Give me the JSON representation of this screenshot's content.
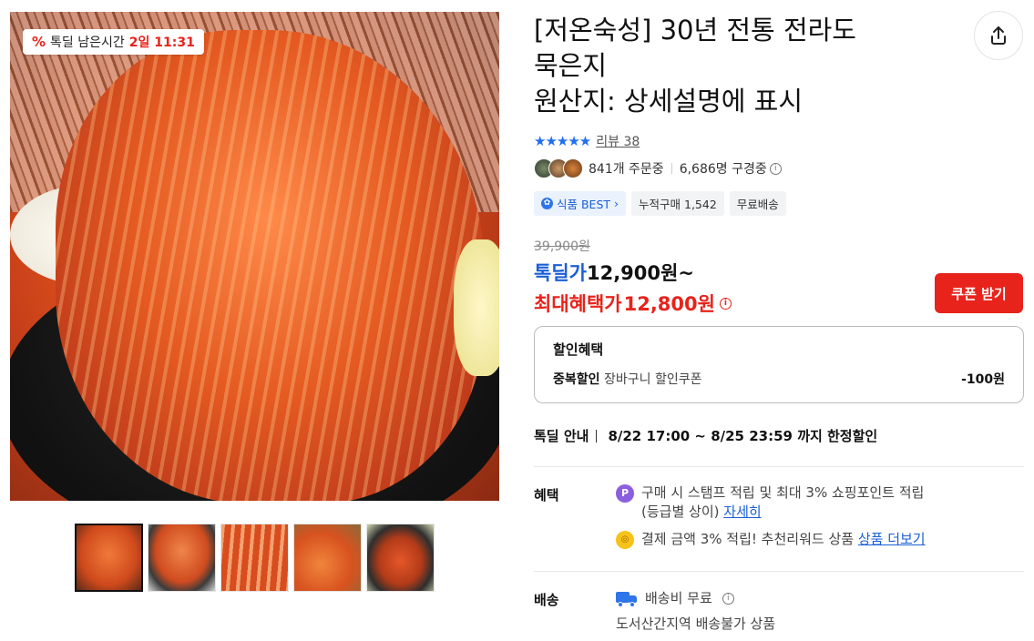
{
  "product": {
    "deal_badge": {
      "label": "톡딜 남은시간",
      "time": "2일 11:31"
    },
    "title_lines": [
      "[저온숙성] 30년 전통 전라도",
      "묵은지",
      "원산지: 상세설명에 표시"
    ],
    "rating": {
      "stars": "★★★★★",
      "review_label": "리뷰 38"
    },
    "orders": {
      "ordering": "841개 주문중",
      "subscribers": "6,686명 구경중"
    },
    "tags": [
      "식품 BEST",
      "누적구매 1,542",
      "무료배송"
    ],
    "prices": {
      "original": "39,900원",
      "deal_label": "톡딜가",
      "deal_value": "12,900원~",
      "max_label": "최대혜택가",
      "max_value": "12,800원"
    },
    "coupon_button": "쿠폰 받기",
    "discount_box": {
      "title": "할인혜택",
      "row_label": "중복할인",
      "row_desc": "장바구니 할인쿠폰",
      "row_amount": "-100원"
    },
    "deal_notice": {
      "label": "톡딜 안내",
      "period": "8/22 17:00 ~ 8/25 23:59 까지 한정할인"
    },
    "benefits": {
      "label": "혜택",
      "line1": "구매 시 스탬프 적립 및 최대 3% 쇼핑포인트 적립",
      "line1b": "(등급별 상이)",
      "line1_link": "자세히",
      "line2": "결제 금액 3% 적립! 추천리워드 상품",
      "line2_link": "상품 더보기"
    },
    "shipping": {
      "label": "배송",
      "fee": "배송비 무료",
      "note": "도서산간지역 배송불가 상품"
    }
  },
  "colors": {
    "accent_red": "#e8231b",
    "accent_blue": "#1a5fd6"
  },
  "icons": [
    "share-icon",
    "info-icon",
    "star-icon",
    "truck-icon",
    "point-p-icon",
    "coin-icon"
  ]
}
